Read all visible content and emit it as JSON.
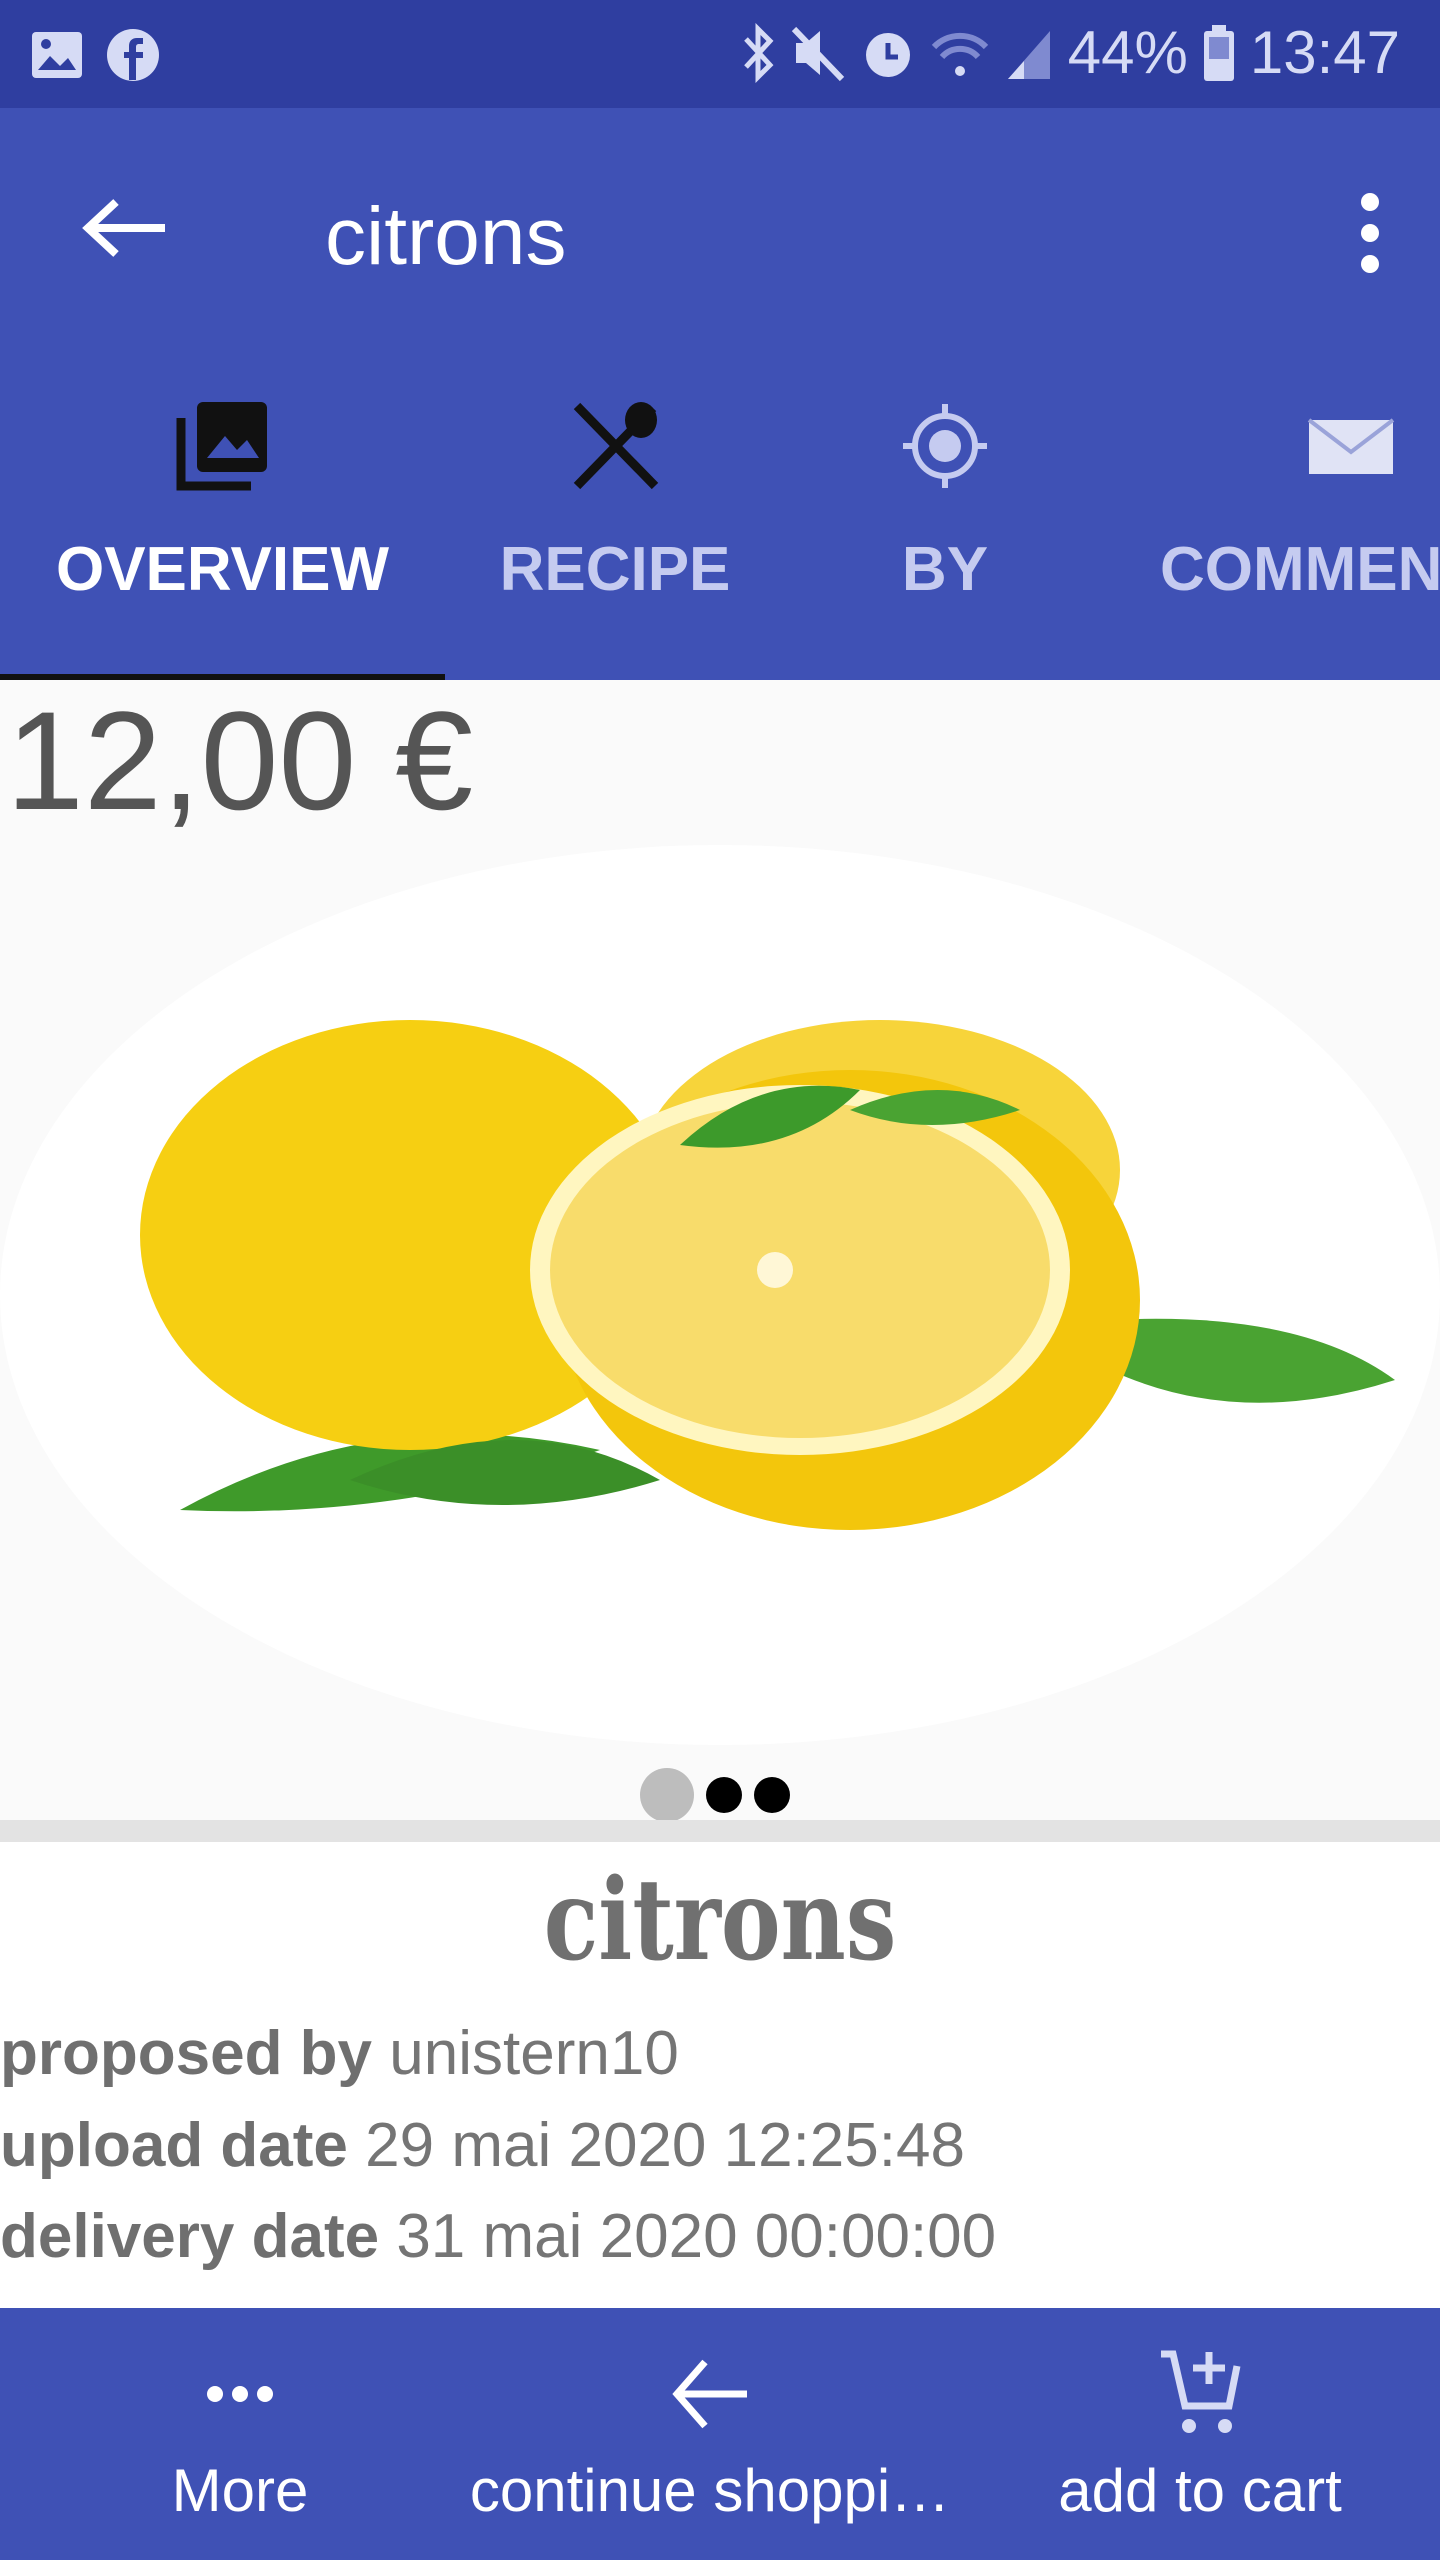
{
  "status_bar": {
    "battery": "44%",
    "time": "13:47",
    "icons": [
      "gallery-icon",
      "facebook-icon",
      "bluetooth-icon",
      "mute-icon",
      "alarm-icon",
      "wifi-icon",
      "signal-icon",
      "battery-icon"
    ]
  },
  "app_bar": {
    "title": "citrons"
  },
  "tabs": [
    {
      "label": "OVERVIEW",
      "icon": "photo-library-icon",
      "active": true
    },
    {
      "label": "RECIPE",
      "icon": "utensils-icon"
    },
    {
      "label": "BY",
      "icon": "location-icon"
    },
    {
      "label": "COMMEN",
      "icon": "mail-icon"
    }
  ],
  "product": {
    "price": "12,00 €",
    "name": "citrons",
    "carousel": {
      "pages": 3,
      "current": 1
    },
    "details": [
      {
        "label": "proposed by",
        "value": "unistern10"
      },
      {
        "label": "upload date",
        "value": "29 mai 2020 12:25:48"
      },
      {
        "label": "delivery date",
        "value": "31 mai 2020 00:00:00"
      }
    ]
  },
  "bottom_nav": {
    "more": "More",
    "continue": "continue shoppi…",
    "cart": "add to cart"
  },
  "colors": {
    "primary": "#3f51b5",
    "status": "#2f3ea0"
  }
}
